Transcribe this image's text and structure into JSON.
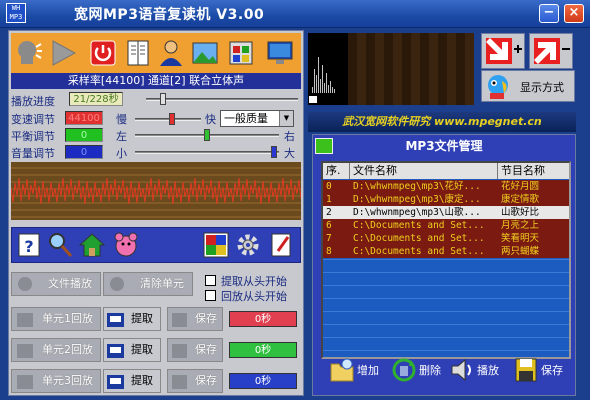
{
  "app": {
    "logo_text": "WH\nMP3",
    "title": "宽网MP3语音复读机  V3.00",
    "min_label": "−",
    "close_label": "×"
  },
  "player": {
    "sample_info": "采样率[44100]  通道[2]  联合立体声",
    "progress_label": "播放进度",
    "progress_value": "21/228秒",
    "progress_fraction": 0.09,
    "speed_label": "变速调节",
    "speed_value": "44100",
    "speed_slow": "慢",
    "speed_fast": "快",
    "quality_selected": "一般质量",
    "balance_label": "平衡调节",
    "balance_value": "0",
    "balance_left": "左",
    "balance_right": "右",
    "volume_label": "音量调节",
    "volume_value": "0",
    "volume_low": "小",
    "volume_high": "大"
  },
  "repeat": {
    "file_play_label": "文件播放",
    "clear_units_label": "清除单元",
    "extract_from_start": "提取从头开始",
    "replay_from_start": "回放从头开始",
    "units": [
      {
        "name": "单元1回放",
        "extract": "提取",
        "save": "保存",
        "time": "0秒",
        "color": "#e04050"
      },
      {
        "name": "单元2回放",
        "extract": "提取",
        "save": "保存",
        "time": "0秒",
        "color": "#30c040"
      },
      {
        "name": "单元3回放",
        "extract": "提取",
        "save": "保存",
        "time": "0秒",
        "color": "#2840c8"
      }
    ]
  },
  "right": {
    "display_mode_label": "显示方式",
    "banner_text": "武汉宽网软件研究  www.mpegnet.cn",
    "file_manager_title": "MP3文件管理",
    "columns": [
      "序.",
      "文件名称",
      "节目名称"
    ],
    "files": [
      {
        "no": "0",
        "path": "D:\\whwnmpeg\\mp3\\花好...",
        "title": "花好月圆",
        "bg": "#7a1a10",
        "fg": "#f0d020"
      },
      {
        "no": "1",
        "path": "D:\\whwnmpeg\\mp3\\康定...",
        "title": "康定情歌",
        "bg": "#7a1a10",
        "fg": "#f0d020"
      },
      {
        "no": "2",
        "path": "D:\\whwnmpeg\\mp3\\山歌...",
        "title": "山歌好比",
        "bg": "#e8e8e8",
        "fg": "#000000"
      },
      {
        "no": "6",
        "path": "C:\\Documents and Set...",
        "title": "月亮之上",
        "bg": "#7a1a10",
        "fg": "#f0d020"
      },
      {
        "no": "7",
        "path": "C:\\Documents and Set...",
        "title": "笑看明天",
        "bg": "#7a1a10",
        "fg": "#f0d020"
      },
      {
        "no": "8",
        "path": "C:\\Documents and Set...",
        "title": "两只蝴蝶",
        "bg": "#7a1a10",
        "fg": "#f0d020"
      }
    ],
    "add_label": "增加",
    "delete_label": "删除",
    "play_label": "播放",
    "save_label": "保存"
  },
  "colors": {
    "window_bg": "#1b3f8c",
    "panel_bg": "#c7c9cf",
    "accent_orange": "#f0a030",
    "file_panel": "#2f3fb5"
  }
}
